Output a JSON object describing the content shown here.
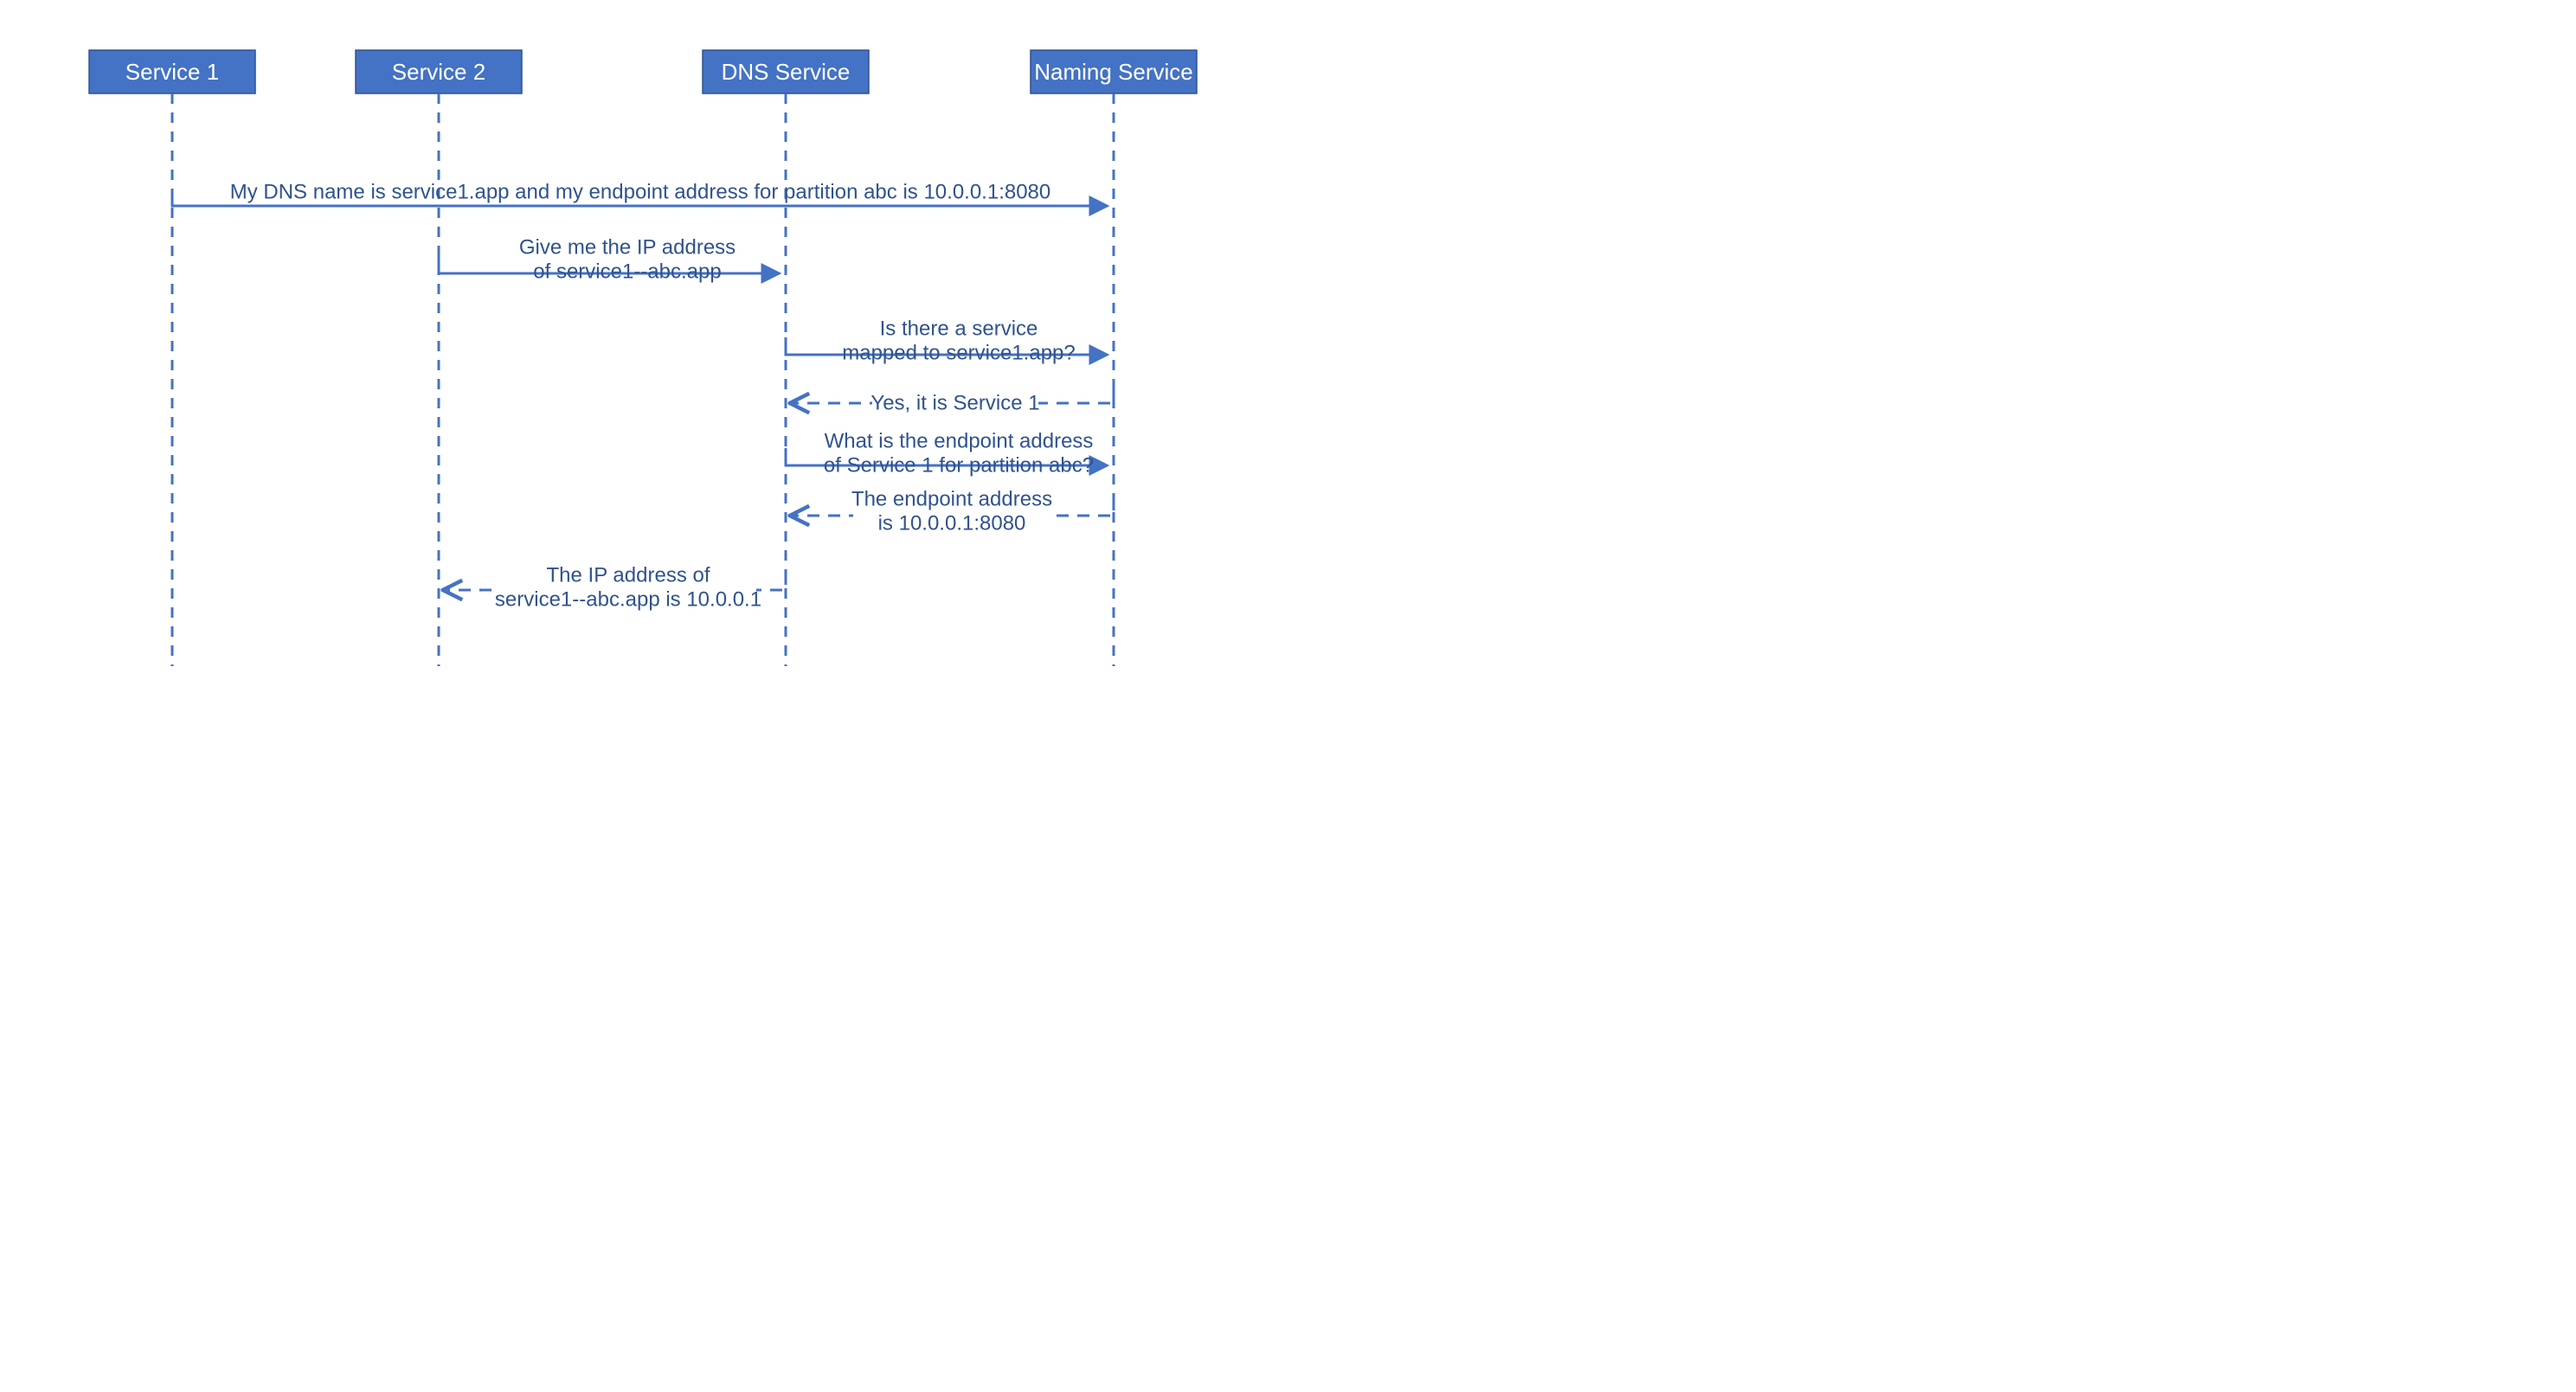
{
  "diagram": {
    "type": "sequence",
    "participants": [
      {
        "id": "service1",
        "label": "Service 1"
      },
      {
        "id": "service2",
        "label": "Service 2"
      },
      {
        "id": "dns",
        "label": "DNS Service"
      },
      {
        "id": "naming",
        "label": "Naming Service"
      }
    ],
    "messages": [
      {
        "id": "m1",
        "from": "service1",
        "to": "naming",
        "style": "solid",
        "lines": [
          "My DNS name is service1.app and my endpoint address for partition abc is 10.0.0.1:8080"
        ]
      },
      {
        "id": "m2",
        "from": "service2",
        "to": "dns",
        "style": "solid",
        "lines": [
          "Give me the IP address",
          "of service1--abc.app"
        ]
      },
      {
        "id": "m3",
        "from": "dns",
        "to": "naming",
        "style": "solid",
        "lines": [
          "Is there a service",
          "mapped to service1.app?"
        ]
      },
      {
        "id": "m4",
        "from": "naming",
        "to": "dns",
        "style": "dash",
        "lines": [
          "Yes, it is Service 1"
        ]
      },
      {
        "id": "m5",
        "from": "dns",
        "to": "naming",
        "style": "solid",
        "lines": [
          "What is the endpoint address",
          "of Service 1 for partition abc?"
        ]
      },
      {
        "id": "m6",
        "from": "naming",
        "to": "dns",
        "style": "dash",
        "lines": [
          "The endpoint address",
          "is 10.0.0.1:8080"
        ]
      },
      {
        "id": "m7",
        "from": "dns",
        "to": "service2",
        "style": "dash",
        "lines": [
          "The IP address of",
          "service1--abc.app is 10.0.0.1"
        ]
      }
    ],
    "colors": {
      "boxFill": "#4472C4",
      "boxStroke": "#2F528F",
      "text": "#2F528F",
      "line": "#4472C4"
    }
  }
}
